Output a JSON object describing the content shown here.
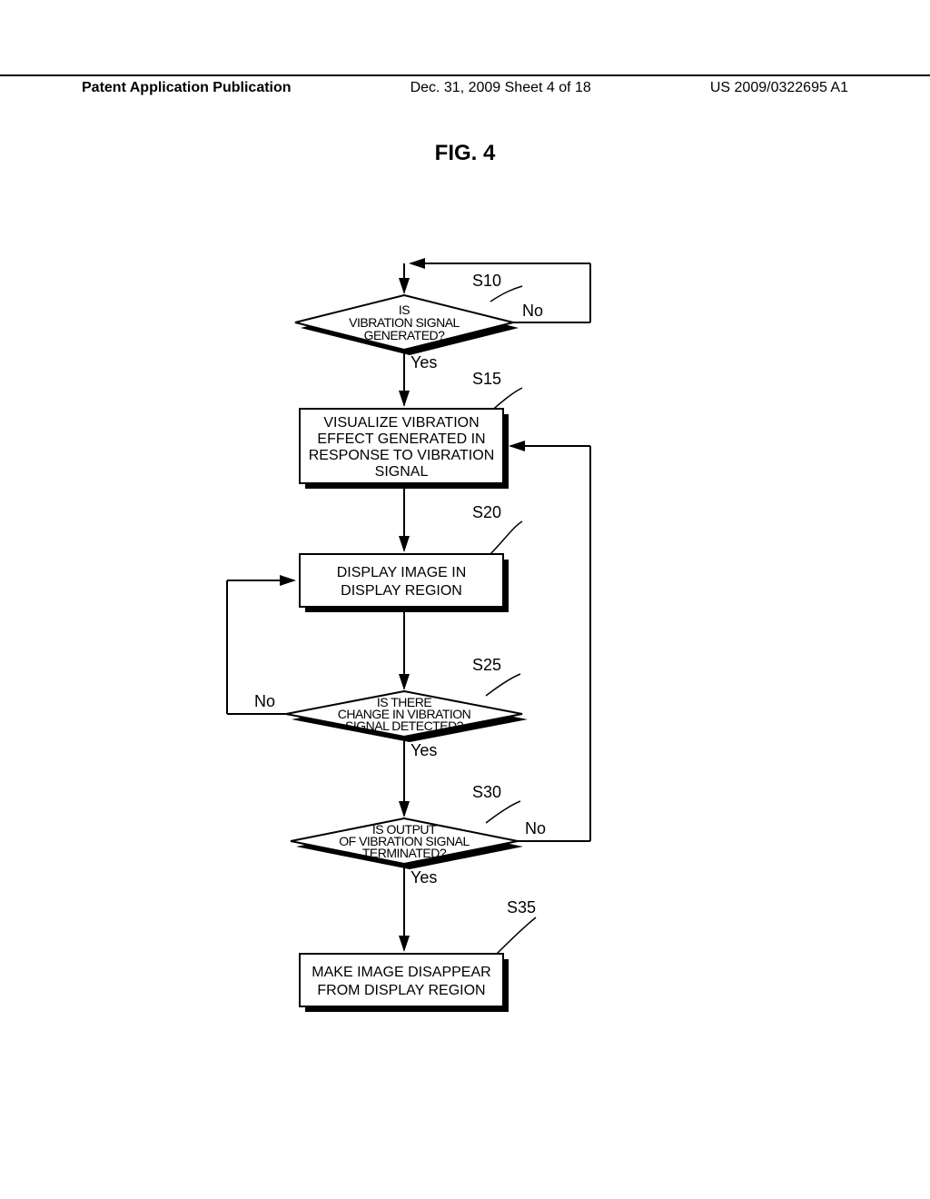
{
  "header": {
    "left": "Patent Application Publication",
    "center": "Dec. 31, 2009  Sheet 4 of 18",
    "right": "US 2009/0322695 A1"
  },
  "figure_label": "FIG. 4",
  "chart_data": {
    "type": "flowchart",
    "title": "FIG. 4",
    "nodes": [
      {
        "id": "S10",
        "type": "decision",
        "text": "IS VIBRATION SIGNAL GENERATED?",
        "label": "S10"
      },
      {
        "id": "S15",
        "type": "process",
        "text": "VISUALIZE VIBRATION EFFECT GENERATED IN RESPONSE TO VIBRATION SIGNAL",
        "label": "S15"
      },
      {
        "id": "S20",
        "type": "process",
        "text": "DISPLAY IMAGE IN DISPLAY REGION",
        "label": "S20"
      },
      {
        "id": "S25",
        "type": "decision",
        "text": "IS THERE CHANGE IN VIBRATION SIGNAL DETECTED?",
        "label": "S25"
      },
      {
        "id": "S30",
        "type": "decision",
        "text": "IS OUTPUT OF VIBRATION SIGNAL TERMINATED?",
        "label": "S30"
      },
      {
        "id": "S35",
        "type": "process",
        "text": "MAKE IMAGE DISAPPEAR FROM DISPLAY REGION",
        "label": "S35"
      }
    ],
    "edges": [
      {
        "from": "start",
        "to": "S10"
      },
      {
        "from": "S10",
        "to": "S15",
        "label": "Yes"
      },
      {
        "from": "S10",
        "to": "S10",
        "label": "No",
        "loop": true
      },
      {
        "from": "S15",
        "to": "S20"
      },
      {
        "from": "S20",
        "to": "S25"
      },
      {
        "from": "S25",
        "to": "S30",
        "label": "Yes"
      },
      {
        "from": "S25",
        "to": "S20",
        "label": "No"
      },
      {
        "from": "S30",
        "to": "S35",
        "label": "Yes"
      },
      {
        "from": "S30",
        "to": "S15",
        "label": "No"
      }
    ]
  },
  "labels": {
    "yes": "Yes",
    "no": "No"
  },
  "steps": {
    "s10": {
      "tag": "S10",
      "l1": "IS",
      "l2": "VIBRATION SIGNAL",
      "l3": "GENERATED?"
    },
    "s15": {
      "tag": "S15",
      "l1": "VISUALIZE VIBRATION",
      "l2": "EFFECT GENERATED IN",
      "l3": "RESPONSE TO VIBRATION",
      "l4": "SIGNAL"
    },
    "s20": {
      "tag": "S20",
      "l1": "DISPLAY IMAGE IN",
      "l2": "DISPLAY REGION"
    },
    "s25": {
      "tag": "S25",
      "l1": "IS THERE",
      "l2": "CHANGE IN VIBRATION",
      "l3": "SIGNAL DETECTED?"
    },
    "s30": {
      "tag": "S30",
      "l1": "IS OUTPUT",
      "l2": "OF VIBRATION SIGNAL",
      "l3": "TERMINATED?"
    },
    "s35": {
      "tag": "S35",
      "l1": "MAKE IMAGE DISAPPEAR",
      "l2": "FROM DISPLAY REGION"
    }
  }
}
